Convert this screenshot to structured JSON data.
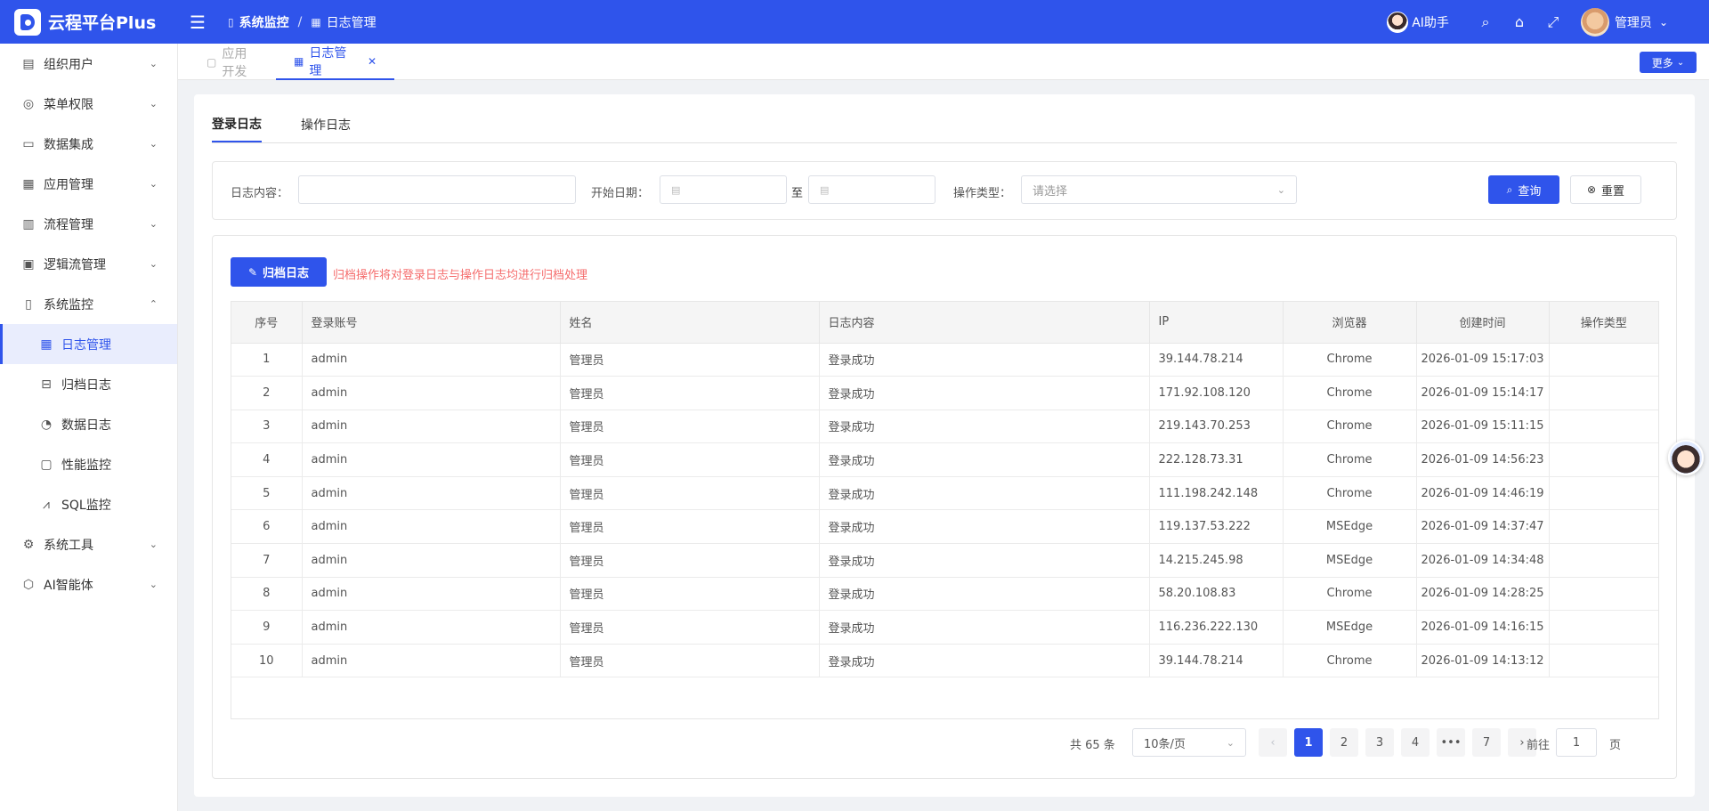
{
  "brand": {
    "name": "云程平台Plus"
  },
  "header": {
    "breadcrumb": [
      "系统监控",
      "日志管理"
    ],
    "ai_label": "AI助手",
    "user_name": "管理员"
  },
  "sidebar": {
    "items": [
      {
        "label": "组织用户",
        "icon": "building-icon"
      },
      {
        "label": "菜单权限",
        "icon": "lifebuoy-icon"
      },
      {
        "label": "数据集成",
        "icon": "briefcase-icon"
      },
      {
        "label": "应用管理",
        "icon": "grid-icon"
      },
      {
        "label": "流程管理",
        "icon": "flow-icon"
      },
      {
        "label": "逻辑流管理",
        "icon": "logic-icon"
      },
      {
        "label": "系统监控",
        "icon": "monitor-icon"
      }
    ],
    "sub_items": [
      {
        "label": "日志管理",
        "icon": "table-icon"
      },
      {
        "label": "归档日志",
        "icon": "archive-icon"
      },
      {
        "label": "数据日志",
        "icon": "gauge-icon"
      },
      {
        "label": "性能监控",
        "icon": "chip-icon"
      },
      {
        "label": "SQL监控",
        "icon": "sql-icon"
      }
    ],
    "bottom_items": [
      {
        "label": "系统工具",
        "icon": "gear-icon"
      },
      {
        "label": "AI智能体",
        "icon": "cube-icon"
      }
    ]
  },
  "tabs": [
    {
      "label": "应用开发"
    },
    {
      "label": "日志管理"
    }
  ],
  "more_label": "更多",
  "subtabs": [
    "登录日志",
    "操作日志"
  ],
  "filters": {
    "content_label": "日志内容：",
    "start_label": "开始日期：",
    "to_label": "至",
    "type_label": "操作类型：",
    "type_placeholder": "请选择",
    "query_label": "查询",
    "reset_label": "重置"
  },
  "archive": {
    "button_label": "归档日志",
    "tip": "归档操作将对登录日志与操作日志均进行归档处理"
  },
  "table": {
    "columns": [
      "序号",
      "登录账号",
      "姓名",
      "日志内容",
      "IP",
      "浏览器",
      "创建时间",
      "操作类型"
    ],
    "rows": [
      [
        "1",
        "admin",
        "管理员",
        "登录成功",
        "39.144.78.214",
        "Chrome",
        "2026-01-09 15:17:03",
        ""
      ],
      [
        "2",
        "admin",
        "管理员",
        "登录成功",
        "171.92.108.120",
        "Chrome",
        "2026-01-09 15:14:17",
        ""
      ],
      [
        "3",
        "admin",
        "管理员",
        "登录成功",
        "219.143.70.253",
        "Chrome",
        "2026-01-09 15:11:15",
        ""
      ],
      [
        "4",
        "admin",
        "管理员",
        "登录成功",
        "222.128.73.31",
        "Chrome",
        "2026-01-09 14:56:23",
        ""
      ],
      [
        "5",
        "admin",
        "管理员",
        "登录成功",
        "111.198.242.148",
        "Chrome",
        "2026-01-09 14:46:19",
        ""
      ],
      [
        "6",
        "admin",
        "管理员",
        "登录成功",
        "119.137.53.222",
        "MSEdge",
        "2026-01-09 14:37:47",
        ""
      ],
      [
        "7",
        "admin",
        "管理员",
        "登录成功",
        "14.215.245.98",
        "MSEdge",
        "2026-01-09 14:34:48",
        ""
      ],
      [
        "8",
        "admin",
        "管理员",
        "登录成功",
        "58.20.108.83",
        "Chrome",
        "2026-01-09 14:28:25",
        ""
      ],
      [
        "9",
        "admin",
        "管理员",
        "登录成功",
        "116.236.222.130",
        "MSEdge",
        "2026-01-09 14:16:15",
        ""
      ],
      [
        "10",
        "admin",
        "管理员",
        "登录成功",
        "39.144.78.214",
        "Chrome",
        "2026-01-09 14:13:12",
        ""
      ]
    ]
  },
  "pagination": {
    "total": "共 65 条",
    "page_size": "10条/页",
    "pages": [
      "1",
      "2",
      "3",
      "4",
      "•••",
      "7"
    ],
    "current": "1",
    "goto_prefix": "前往",
    "goto_value": "1",
    "goto_suffix": "页"
  },
  "colors": {
    "primary": "#2f54eb",
    "danger": "#f56c6c"
  }
}
